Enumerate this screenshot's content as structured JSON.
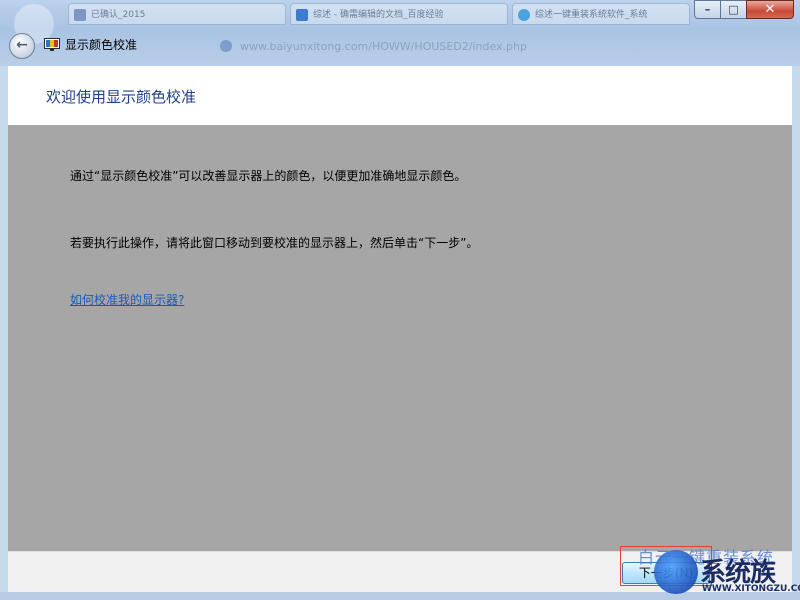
{
  "window": {
    "title": "显示颜色校准",
    "controls": {
      "minimize_glyph": "–",
      "maximize_glyph": "□",
      "close_glyph": "✕"
    }
  },
  "background_browser": {
    "tabs": [
      "已确认_2015",
      "综述 - 确需编辑的文档_百度经验",
      "综述一键重装系统软件_系统"
    ],
    "url": "www.baiyunxitong.com/HOWW/HOUSED2/index.php"
  },
  "header": {
    "title": "欢迎使用显示颜色校准"
  },
  "content": {
    "paragraph_1": "通过“显示颜色校准”可以改善显示器上的颜色，以便更加准确地显示颜色。",
    "paragraph_2": "若要执行此操作，请将此窗口移动到要校准的显示器上，然后单击“下一步”。",
    "help_link": "如何校准我的显示器?"
  },
  "footer": {
    "next_label": "下一步(N)"
  },
  "watermark": {
    "top_text": "白云一键重装系统",
    "big_text": "系统族",
    "url": "WWW.XITONGZU.COM"
  },
  "colors": {
    "header_title": "#1e3f8a",
    "link": "#1b5bb5",
    "content_bg": "#a6a6a6",
    "highlight": "#e0413a"
  },
  "icons": {
    "back": "back-arrow-icon",
    "app": "display-color-calibration-icon"
  }
}
